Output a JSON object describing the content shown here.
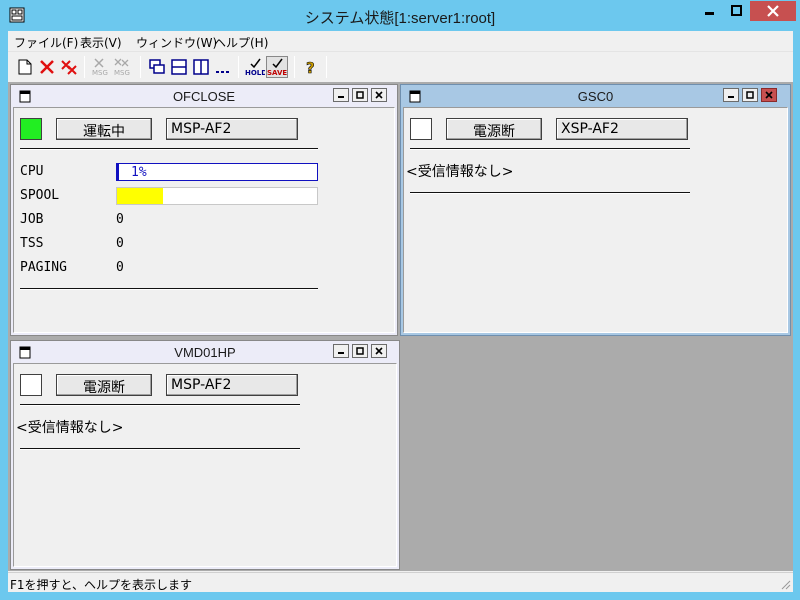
{
  "window": {
    "title": "システム状態[1:server1:root]"
  },
  "menu": [
    "ファイル(F)",
    "表示(V)",
    "ウィンドウ(W)",
    "ヘルプ(H)"
  ],
  "toolbar": {
    "buttons": [
      "new-icon",
      "delete-icon",
      "delete-all-icon",
      "msg-icon",
      "msg-all-icon",
      "cascade-icon",
      "tile-horizontal-icon",
      "tile-vertical-icon",
      "arrange-icons-icon",
      "hold-icon",
      "save-icon",
      "help-icon"
    ],
    "hold_label": "HOLD",
    "save_label": "SAVE",
    "msg_label": "MSG",
    "help_label": "?"
  },
  "colors": {
    "titlebar": "#6cc8ee",
    "active_child": "#a8c8e4",
    "running": "#22ee22",
    "spool_fill": "#ffff00",
    "cpu_fill": "#1010c0"
  },
  "panels": {
    "ofclose": {
      "title": "OFCLOSE",
      "status": "運転中",
      "system": "MSP-AF2",
      "status_color": "#22ee22",
      "metrics": {
        "cpu": {
          "label": "CPU",
          "value_text": "1%",
          "fraction": 0.01
        },
        "spool": {
          "label": "SPOOL",
          "value_text": "23%",
          "fraction": 0.23
        },
        "job": {
          "label": "JOB",
          "value": "0"
        },
        "tss": {
          "label": "TSS",
          "value": "0"
        },
        "paging": {
          "label": "PAGING",
          "value": "0"
        }
      }
    },
    "gsc0": {
      "title": "GSC0",
      "status": "電源断",
      "system": "XSP-AF2",
      "message": "<受信情報なし>"
    },
    "vmd01hp": {
      "title": "VMD01HP",
      "status": "電源断",
      "system": "MSP-AF2",
      "message": "<受信情報なし>"
    }
  },
  "statusbar": {
    "text": "F1を押すと、ヘルプを表示します"
  }
}
